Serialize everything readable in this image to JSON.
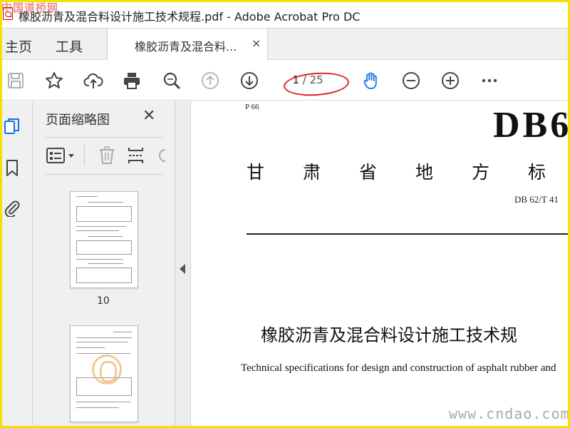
{
  "window": {
    "title": "橡胶沥青及混合料设计施工技术规程.pdf - Adobe Acrobat Pro DC",
    "watermark_top_left": "中国道桥网"
  },
  "tabs": {
    "home": "主页",
    "tools": "工具",
    "document": "橡胶沥青及混合料...",
    "close": "×"
  },
  "toolbar": {
    "icons": [
      "save-icon",
      "bookmark-star-icon",
      "upload-icon",
      "print-icon",
      "find-icon",
      "page-up-icon",
      "page-down-icon",
      "hand-tool-icon",
      "zoom-out-icon",
      "zoom-in-icon",
      "more-icon"
    ],
    "page_current": "1",
    "page_total": "/ 25"
  },
  "left_rail": {
    "icons": [
      "page-thumbnails-icon",
      "bookmarks-icon",
      "attachments-icon"
    ]
  },
  "thumbnails_pane": {
    "title": "页面缩略图",
    "close": "✕",
    "tools": [
      "thumbnail-options-icon",
      "delete-page-icon",
      "insert-page-icon"
    ],
    "pages": [
      {
        "label": "10"
      },
      {
        "label": ""
      }
    ]
  },
  "document": {
    "header_left": "P 66",
    "standard_mark": "DB6",
    "province_line": "甘肃省地方标",
    "standard_number": "DB 62/T 41",
    "title_cn": "橡胶沥青及混合料设计施工技术规",
    "title_en": "Technical specifications for design and construction of asphalt rubber and"
  },
  "watermark_bottom_right": "www.cndao.com",
  "colors": {
    "accent_blue": "#1473e6",
    "annotation_red": "#e0231f",
    "frame_yellow": "#f2e200"
  }
}
